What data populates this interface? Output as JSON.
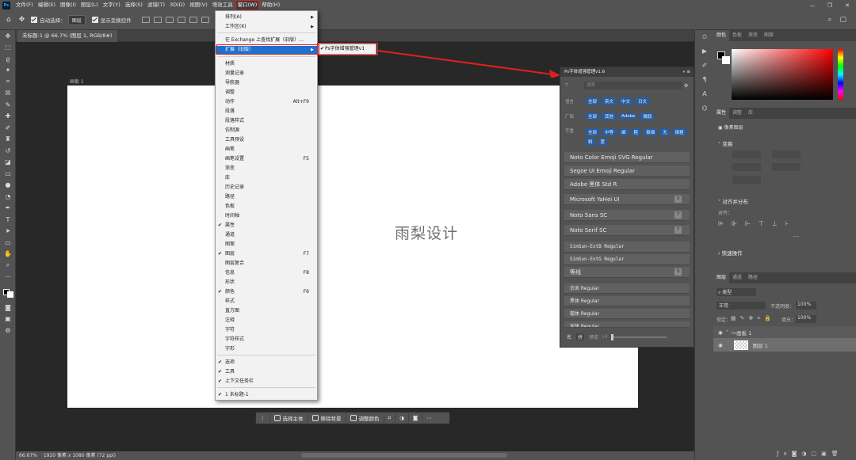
{
  "menubar": {
    "logo": "Ps",
    "items": [
      "文件(F)",
      "编辑(E)",
      "图像(I)",
      "图层(L)",
      "文字(Y)",
      "选择(S)",
      "滤镜(T)",
      "3D(D)",
      "视图(V)",
      "增效工具",
      "窗口(W)",
      "帮助(H)"
    ]
  },
  "options": {
    "auto_select_label": "自动选择：",
    "auto_select_value": "图层",
    "show_transform_label": "显示变换控件"
  },
  "document": {
    "tab_title": "未标题-1 @ 66.7% (图层 1, RGB/8#)",
    "artboard_label": "画板 1",
    "canvas_text": "雨梨设计"
  },
  "window_menu": {
    "items": [
      {
        "label": "排列(A)",
        "submenu": true
      },
      {
        "label": "工作区(K)",
        "submenu": true
      },
      {
        "label": "在 Exchange 上查找扩展（旧版）..."
      },
      {
        "label": "扩展（旧版）",
        "submenu": true,
        "highlighted": true
      },
      {
        "label": "材质"
      },
      {
        "label": "测量记录"
      },
      {
        "label": "导航器"
      },
      {
        "label": "调整"
      },
      {
        "label": "动作",
        "shortcut": "Alt+F9"
      },
      {
        "label": "段落"
      },
      {
        "label": "段落样式"
      },
      {
        "label": "仿制源"
      },
      {
        "label": "工具预设"
      },
      {
        "label": "画笔"
      },
      {
        "label": "画笔设置",
        "shortcut": "F5"
      },
      {
        "label": "渐变"
      },
      {
        "label": "库"
      },
      {
        "label": "历史记录"
      },
      {
        "label": "路径"
      },
      {
        "label": "色板"
      },
      {
        "label": "时间轴"
      },
      {
        "label": "属性",
        "checked": true
      },
      {
        "label": "通道"
      },
      {
        "label": "图案"
      },
      {
        "label": "图层",
        "shortcut": "F7",
        "checked": true
      },
      {
        "label": "图层复合"
      },
      {
        "label": "信息",
        "shortcut": "F8"
      },
      {
        "label": "形状"
      },
      {
        "label": "颜色",
        "shortcut": "F6",
        "checked": true
      },
      {
        "label": "样式"
      },
      {
        "label": "直方图"
      },
      {
        "label": "注释"
      },
      {
        "label": "字符"
      },
      {
        "label": "字符样式"
      },
      {
        "label": "字形"
      },
      {
        "label": "选项",
        "checked": true
      },
      {
        "label": "工具",
        "checked": true
      },
      {
        "label": "上下文任务栏",
        "checked": true
      },
      {
        "label": "1 未标题-1",
        "checked": true
      }
    ],
    "submenu_item": "Ps字体增强管理v1"
  },
  "plugin": {
    "title": "Ps字体增强管理v1.6",
    "search_placeholder": "搜索",
    "lang_label": "语言",
    "lang_chips": [
      "全部",
      "英文",
      "中文",
      "日文"
    ],
    "vendor_label": "厂商",
    "vendor_chips": [
      "全部",
      "其他",
      "Adobe",
      "微软"
    ],
    "weight_label": "字重",
    "weight_chips": [
      "全部",
      "中等",
      "细",
      "粗",
      "极细",
      "无",
      "极粗",
      "斜",
      "宽"
    ],
    "fonts": [
      {
        "name": "Noto Color Emoji SVG Regular",
        "badge": ""
      },
      {
        "name": "Segoe UI Emoji Regular",
        "badge": ""
      },
      {
        "name": "Adobe 黑体 Std R",
        "badge": ""
      },
      {
        "name": "Microsoft YaHei UI",
        "badge": "3"
      },
      {
        "name": "Noto Sans SC",
        "badge": "7"
      },
      {
        "name": "Noto Serif SC",
        "badge": "7"
      },
      {
        "name": "SimSun-ExtB Regular",
        "badge": ""
      },
      {
        "name": "SimSun-ExtG Regular",
        "badge": ""
      },
      {
        "name": "等线",
        "badge": "3"
      },
      {
        "name": "仿宋 Regular",
        "badge": ""
      },
      {
        "name": "黑体 Regular",
        "badge": ""
      },
      {
        "name": "楷体 Regular",
        "badge": ""
      },
      {
        "name": "宋体 Regular",
        "badge": ""
      }
    ],
    "footer": {
      "name_tab": "名",
      "pinyin_tab": "拼",
      "preview_label": "预览",
      "size": "14"
    }
  },
  "right_panel": {
    "color_tabs": [
      "颜色",
      "色板",
      "渐变",
      "图案"
    ],
    "prop_tabs": [
      "属性",
      "调整",
      "库"
    ],
    "pixel_layer": "像素图层",
    "transform": "变换",
    "align": "对齐并分布",
    "align_sub": "对齐：",
    "quick_actions": "快速操作",
    "layer_tabs": [
      "图层",
      "通道",
      "路径"
    ],
    "filter_type": "类型",
    "blend_mode": "正常",
    "opacity_label": "不透明度：",
    "opacity": "100%",
    "lock_label": "锁定：",
    "fill_label": "填充：",
    "fill": "100%",
    "layers": [
      {
        "name": "画板 1"
      },
      {
        "name": "图层 1"
      }
    ]
  },
  "context_bar": {
    "btn1": "选择主体",
    "btn2": "移除背景",
    "btn3": "调整颜色"
  },
  "status": {
    "zoom": "66.67%",
    "info": "1920 像素 x 1080 像素 (72 ppi)"
  },
  "colors": {
    "accent": "#1e6fd0",
    "highlight_box": "#e02020"
  }
}
